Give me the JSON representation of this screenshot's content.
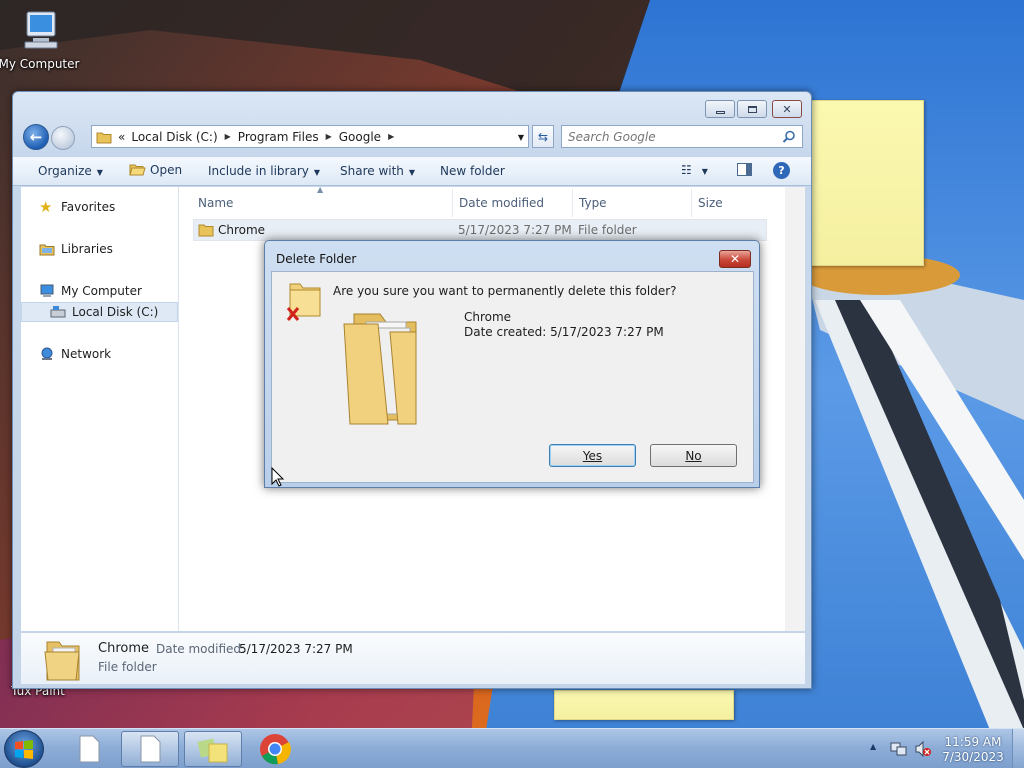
{
  "desktop": {
    "icons": [
      {
        "label": "My Computer"
      },
      {
        "label": "Tux Paint"
      }
    ]
  },
  "explorer": {
    "address": {
      "overflow": "«",
      "crumbs": [
        "Local Disk (C:)",
        "Program Files",
        "Google"
      ]
    },
    "search": {
      "placeholder": "Search Google"
    },
    "commands": {
      "organize": "Organize",
      "open": "Open",
      "include": "Include in library",
      "share": "Share with",
      "new_folder": "New folder"
    },
    "nav": {
      "favorites": "Favorites",
      "libraries": "Libraries",
      "my_computer": "My Computer",
      "local_disk": "Local Disk (C:)",
      "network": "Network"
    },
    "columns": {
      "name": "Name",
      "date": "Date modified",
      "type": "Type",
      "size": "Size"
    },
    "files": [
      {
        "name": "Chrome",
        "date": "5/17/2023 7:27 PM",
        "type": "File folder",
        "size": ""
      }
    ],
    "details": {
      "name": "Chrome",
      "date_label": "Date modified:",
      "date_value": "5/17/2023 7:27 PM",
      "type": "File folder"
    }
  },
  "dialog": {
    "title": "Delete Folder",
    "question": "Are you sure you want to permanently delete this folder?",
    "item_name": "Chrome",
    "item_date": "Date created: 5/17/2023 7:27 PM",
    "yes_label": "Yes",
    "no_label": "No"
  },
  "taskbar": {
    "time": "11:59 AM",
    "date": "7/30/2023"
  },
  "colors": {
    "accent": "#1e5fb3",
    "dialog_close": "#c9473a",
    "taskbar": "#8eaed8"
  }
}
